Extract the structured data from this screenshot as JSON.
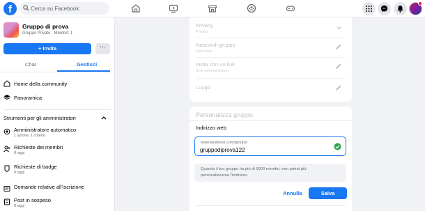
{
  "header": {
    "logo": "f",
    "search_placeholder": "Cerca su Facebook",
    "nav_icons": [
      "home-icon",
      "video-icon",
      "marketplace-icon",
      "groups-icon",
      "gaming-icon"
    ],
    "right_icons": [
      "menu-grid-icon",
      "messenger-icon",
      "bell-icon",
      "account-avatar"
    ]
  },
  "group": {
    "name": "Gruppo di prova",
    "meta": "Gruppo Privato · Membri: 1",
    "invite_label": "+ Invita",
    "more_label": "···"
  },
  "tabs": [
    "Chat",
    "Gestisci"
  ],
  "nav": {
    "home": "Home della community",
    "overview": "Panoramica"
  },
  "admin_tools": {
    "title": "Strumenti per gli amministratori",
    "items": [
      {
        "title": "Amministratore automatico",
        "sub": "1 azione, 1 criterio"
      },
      {
        "title": "Richieste dei membri",
        "sub": "0 oggi"
      },
      {
        "title": "Richieste di badge",
        "sub": "0 oggi"
      },
      {
        "title": "Domande relative all'iscrizione",
        "sub": ""
      },
      {
        "title": "Post in sospeso",
        "sub": "0 oggi"
      }
    ]
  },
  "settings": [
    {
      "title": "Privacy",
      "sub": "Privato",
      "icon": "chevron-down-icon"
    },
    {
      "title": "Nascondi gruppo",
      "sub": "Nascosto",
      "icon": "pencil-icon"
    },
    {
      "title": "Invita con un link",
      "sub": "Solo amministratori",
      "icon": "pencil-icon"
    },
    {
      "title": "Luogo",
      "sub": "",
      "icon": "pencil-icon"
    }
  ],
  "customize": {
    "title": "Personalizza gruppo",
    "web_label": "Indirizzo web",
    "web_prefix": "www.facebook.com/groups/",
    "web_value": "gruppodiprova122",
    "info_line1": "Quando il tuo gruppo ha più di 5000 membri, non potrai più",
    "info_line2": "personalizzarne l'indirizzo.",
    "cancel_label": "Annulla",
    "save_label": "Salva"
  },
  "colors": {
    "accent": "#1877f2",
    "success": "#31a24c",
    "notification": "#e41e3f"
  }
}
